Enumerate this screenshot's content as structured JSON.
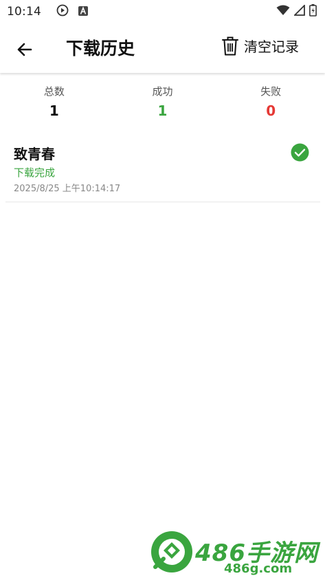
{
  "status_bar": {
    "time": "10:14",
    "icons": [
      "play-circle-icon",
      "a-letter-icon",
      "wifi-icon",
      "signal-icon",
      "battery-icon"
    ]
  },
  "app_bar": {
    "title": "下载历史",
    "back_icon": "arrow-left-icon",
    "clear_label": "清空记录",
    "clear_icon": "trash-icon"
  },
  "stats": {
    "total_label": "总数",
    "total_value": "1",
    "success_label": "成功",
    "success_value": "1",
    "failed_label": "失败",
    "failed_value": "0"
  },
  "records": [
    {
      "title": "致青春",
      "status": "下载完成",
      "time": "2025/8/25 上午10:14:17",
      "icon": "check-circle-icon"
    }
  ],
  "watermark": {
    "big": "486手游网",
    "small": "486g.com"
  },
  "colors": {
    "success": "#3aa53f",
    "failed": "#e53935",
    "muted": "#888888"
  }
}
